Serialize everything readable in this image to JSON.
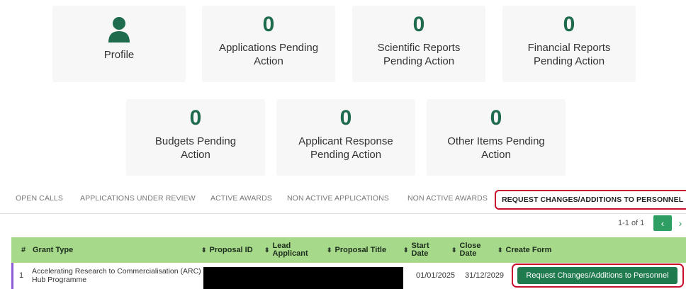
{
  "tiles_row1": [
    {
      "count": "",
      "label": "Profile"
    },
    {
      "count": "0",
      "label": "Applications Pending Action"
    },
    {
      "count": "0",
      "label": "Scientific Reports Pending Action"
    },
    {
      "count": "0",
      "label": "Financial Reports Pending Action"
    }
  ],
  "tiles_row2": [
    {
      "count": "0",
      "label": "Budgets Pending Action"
    },
    {
      "count": "0",
      "label": "Applicant Response Pending Action"
    },
    {
      "count": "0",
      "label": "Other Items Pending Action"
    }
  ],
  "tabs": [
    {
      "label": "OPEN CALLS"
    },
    {
      "label": "APPLICATIONS UNDER REVIEW"
    },
    {
      "label": "ACTIVE AWARDS"
    },
    {
      "label": "NON ACTIVE APPLICATIONS"
    },
    {
      "label": "NON ACTIVE AWARDS"
    },
    {
      "label": "REQUEST CHANGES/ADDITIONS TO PERSONNEL",
      "active": true
    }
  ],
  "pagination": {
    "text": "1-1 of 1",
    "prev": "‹",
    "next": "›"
  },
  "table": {
    "headers": [
      "#",
      "Grant Type",
      "Proposal ID",
      "Lead Applicant",
      "Proposal Title",
      "Start Date",
      "Close Date",
      "Create Form"
    ],
    "rows": [
      {
        "index": "1",
        "grant_type": "Accelerating Research to Commercialisation (ARC) Hub Programme",
        "start_date": "01/01/2025",
        "close_date": "31/12/2029",
        "action_label": "Request Changes/Additions to Personnel"
      }
    ]
  },
  "colors": {
    "accent": "#1f6b4e",
    "header_bg": "#a7d98b",
    "button": "#1f7a4e",
    "highlight": "#c8102e"
  }
}
